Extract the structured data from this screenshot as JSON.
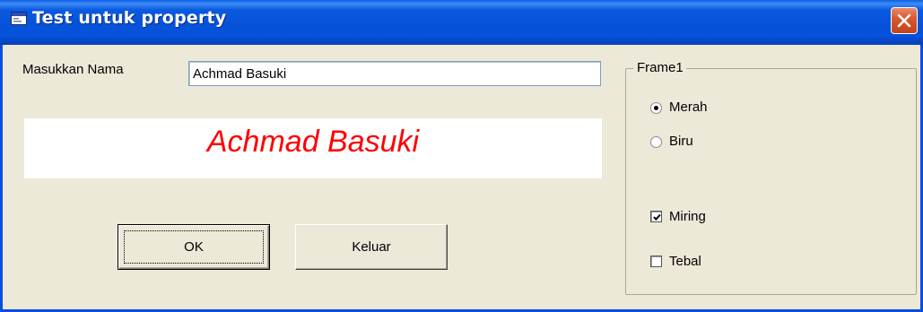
{
  "window": {
    "title": "Test untuk property"
  },
  "form": {
    "name_label": "Masukkan Nama",
    "name_value": "Achmad Basuki",
    "display_text": "Achmad Basuki",
    "display_color": "#ff0000",
    "ok_label": "OK",
    "exit_label": "Keluar"
  },
  "frame": {
    "title": "Frame1",
    "radio_red_label": "Merah",
    "radio_red_checked": true,
    "radio_blue_label": "Biru",
    "radio_blue_checked": false,
    "check_italic_label": "Miring",
    "check_italic_checked": true,
    "check_bold_label": "Tebal",
    "check_bold_checked": false
  },
  "icons": {
    "title": "app-form-icon",
    "close": "close-icon"
  }
}
